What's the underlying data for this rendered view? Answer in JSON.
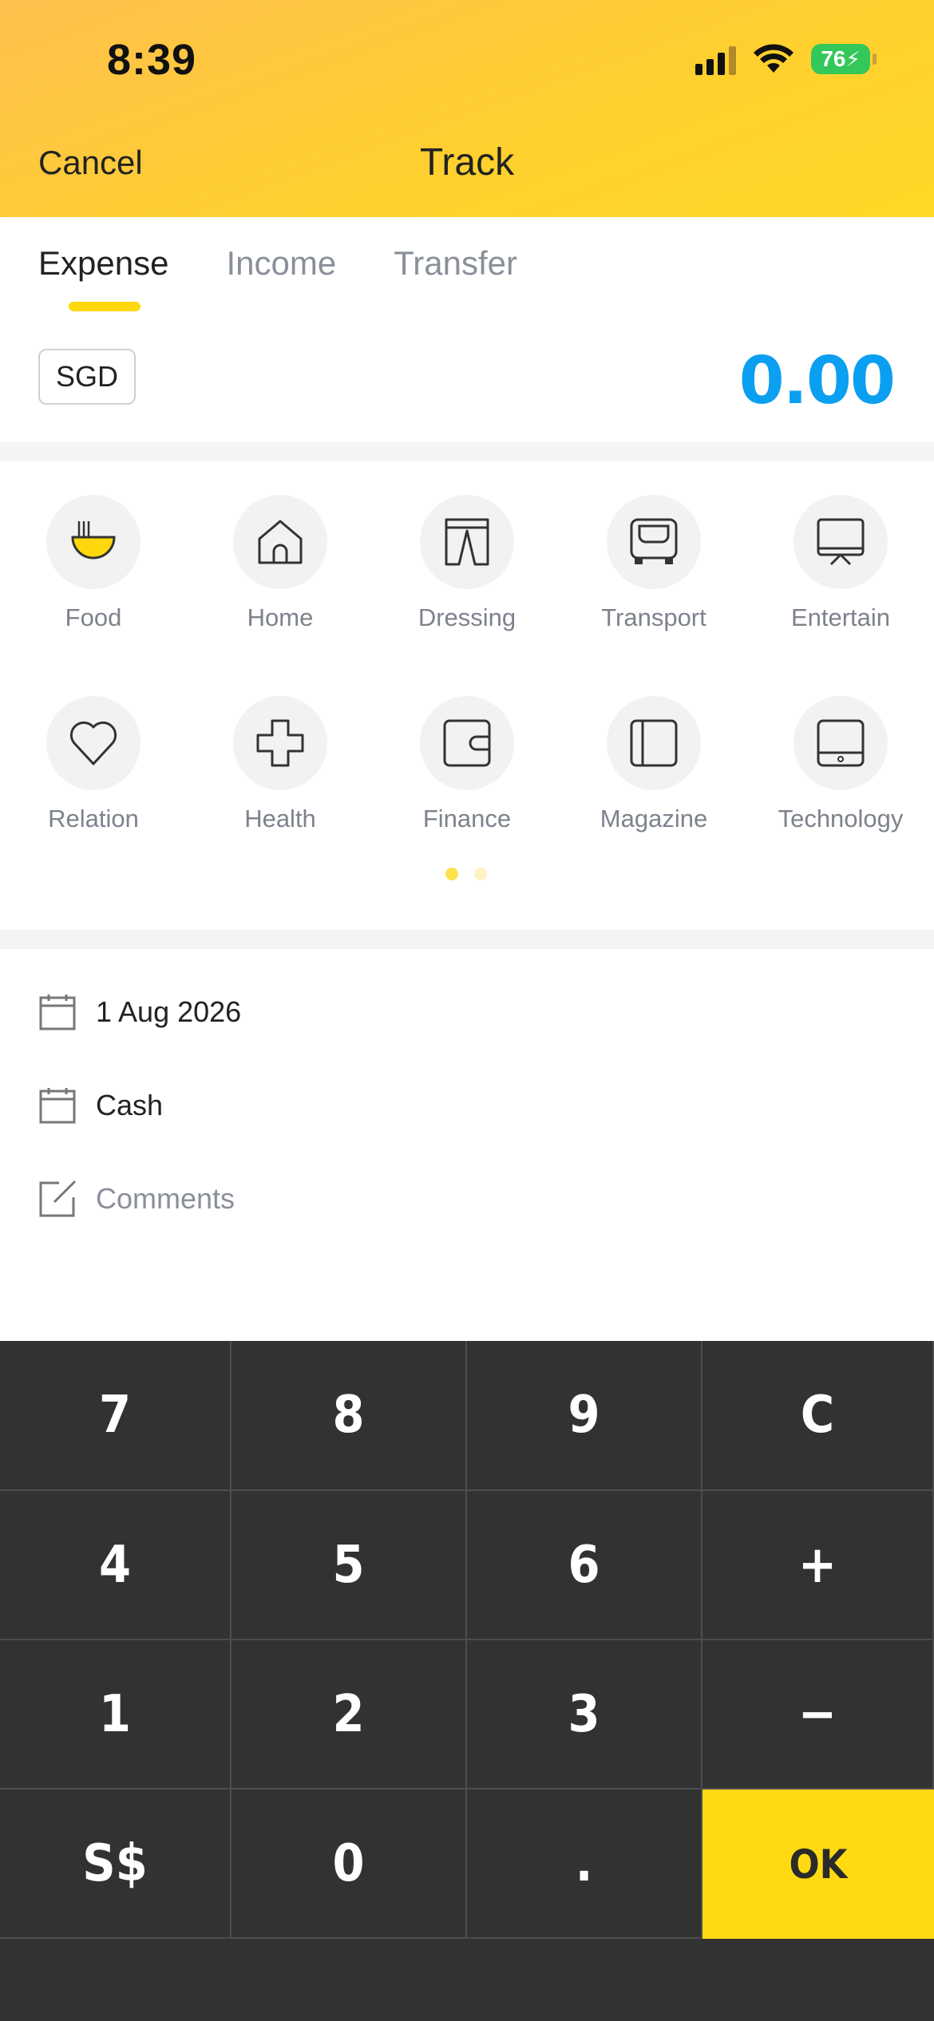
{
  "status_bar": {
    "time": "8:39",
    "battery": "76"
  },
  "header": {
    "cancel_label": "Cancel",
    "title": "Track"
  },
  "tabs": [
    {
      "label": "Expense",
      "active": true
    },
    {
      "label": "Income",
      "active": false
    },
    {
      "label": "Transfer",
      "active": false
    }
  ],
  "currency": "SGD",
  "amount": "0.00",
  "categories": [
    {
      "label": "Food",
      "icon": "food-bowl-icon"
    },
    {
      "label": "Home",
      "icon": "home-icon"
    },
    {
      "label": "Dressing",
      "icon": "pants-icon"
    },
    {
      "label": "Transport",
      "icon": "bus-icon"
    },
    {
      "label": "Entertain",
      "icon": "monitor-icon"
    },
    {
      "label": "Relation",
      "icon": "heart-icon"
    },
    {
      "label": "Health",
      "icon": "cross-icon"
    },
    {
      "label": "Finance",
      "icon": "wallet-icon"
    },
    {
      "label": "Magazine",
      "icon": "book-icon"
    },
    {
      "label": "Technology",
      "icon": "tablet-icon"
    }
  ],
  "pager": {
    "pages": 2,
    "current": 1
  },
  "details": {
    "date": "1 Aug 2026",
    "account": "Cash",
    "comments_placeholder": "Comments"
  },
  "keypad": {
    "keys": [
      "7",
      "8",
      "9",
      "C",
      "4",
      "5",
      "6",
      "+",
      "1",
      "2",
      "3",
      "−",
      "S$",
      "0",
      ".",
      "OK"
    ]
  },
  "colors": {
    "accent": "#ffd80c",
    "amount": "#0a9ff0",
    "keypad_bg": "#323232"
  }
}
